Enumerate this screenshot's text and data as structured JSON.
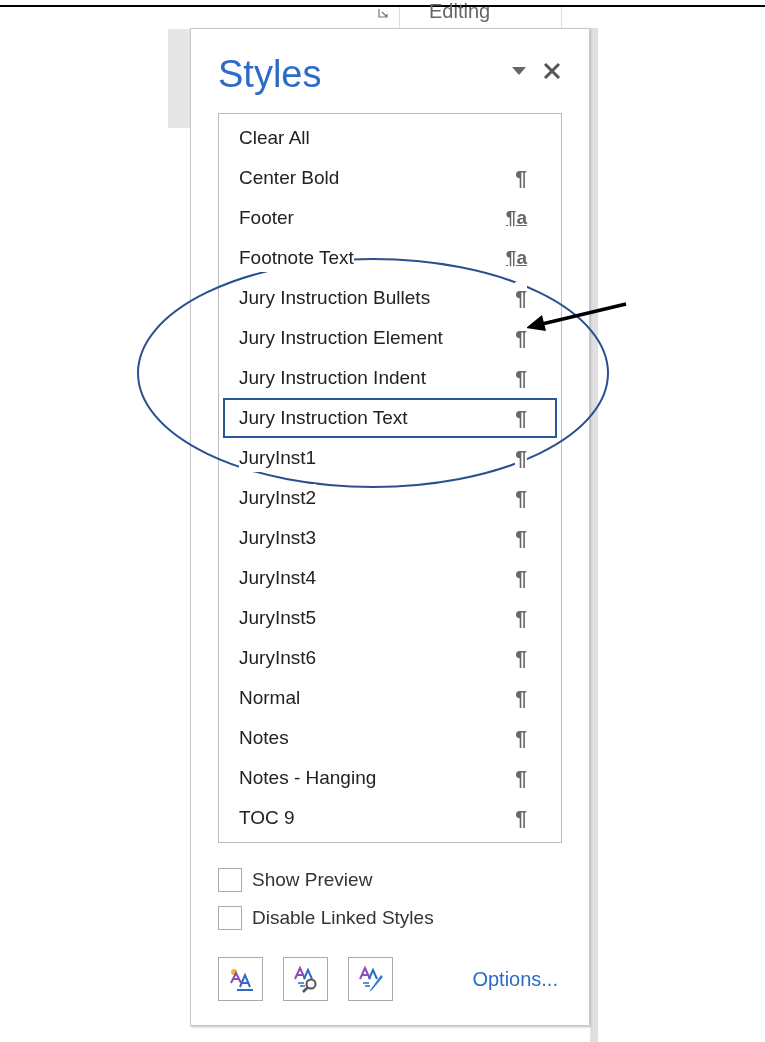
{
  "ribbon": {
    "group_label": "Editing"
  },
  "pane": {
    "title": "Styles",
    "styles": [
      {
        "name": "Clear All",
        "kind": "none",
        "selected": false
      },
      {
        "name": "Center Bold",
        "kind": "paragraph",
        "mark": "¶",
        "selected": false
      },
      {
        "name": "Footer",
        "kind": "linked",
        "mark": "¶a",
        "selected": false
      },
      {
        "name": "Footnote Text",
        "kind": "linked",
        "mark": "¶a",
        "selected": false
      },
      {
        "name": "Jury Instruction Bullets",
        "kind": "paragraph",
        "mark": "¶",
        "selected": false
      },
      {
        "name": "Jury Instruction Element",
        "kind": "paragraph",
        "mark": "¶",
        "selected": false
      },
      {
        "name": "Jury Instruction Indent",
        "kind": "paragraph",
        "mark": "¶",
        "selected": false
      },
      {
        "name": "Jury Instruction Text",
        "kind": "paragraph",
        "mark": "¶",
        "selected": true
      },
      {
        "name": "JuryInst1",
        "kind": "paragraph",
        "mark": "¶",
        "selected": false
      },
      {
        "name": "JuryInst2",
        "kind": "paragraph",
        "mark": "¶",
        "selected": false
      },
      {
        "name": "JuryInst3",
        "kind": "paragraph",
        "mark": "¶",
        "selected": false
      },
      {
        "name": "JuryInst4",
        "kind": "paragraph",
        "mark": "¶",
        "selected": false
      },
      {
        "name": "JuryInst5",
        "kind": "paragraph",
        "mark": "¶",
        "selected": false
      },
      {
        "name": "JuryInst6",
        "kind": "paragraph",
        "mark": "¶",
        "selected": false
      },
      {
        "name": "Normal",
        "kind": "paragraph",
        "mark": "¶",
        "selected": false
      },
      {
        "name": "Notes",
        "kind": "paragraph",
        "mark": "¶",
        "selected": false
      },
      {
        "name": "Notes - Hanging",
        "kind": "paragraph",
        "mark": "¶",
        "selected": false
      },
      {
        "name": "TOC 9",
        "kind": "paragraph",
        "mark": "¶",
        "selected": false
      }
    ],
    "options": [
      {
        "label": "Show Preview",
        "checked": false
      },
      {
        "label": "Disable Linked Styles",
        "checked": false
      }
    ],
    "options_link": "Options..."
  }
}
